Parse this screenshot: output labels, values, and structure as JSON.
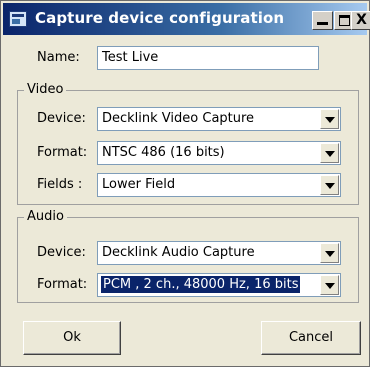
{
  "window": {
    "title": "Capture device configuration",
    "controls": {
      "minimize": "_",
      "maximize": "□",
      "close": "X"
    }
  },
  "name": {
    "label": "Name:",
    "value": "Test Live"
  },
  "video": {
    "group_label": "Video",
    "device": {
      "label": "Device:",
      "value": "Decklink Video Capture"
    },
    "format": {
      "label": "Format:",
      "value": "NTSC 486  (16 bits)"
    },
    "fields": {
      "label": "Fields :",
      "value": "Lower Field"
    }
  },
  "audio": {
    "group_label": "Audio",
    "device": {
      "label": "Device:",
      "value": "Decklink Audio Capture"
    },
    "format": {
      "label": "Format:",
      "value": "PCM , 2 ch., 48000 Hz, 16 bits"
    }
  },
  "buttons": {
    "ok": "Ok",
    "cancel": "Cancel"
  },
  "colors": {
    "titlebar_start": "#0a246a",
    "titlebar_end": "#a6caf0",
    "selection": "#0a246a",
    "dialog_bg": "#ece9d8"
  }
}
